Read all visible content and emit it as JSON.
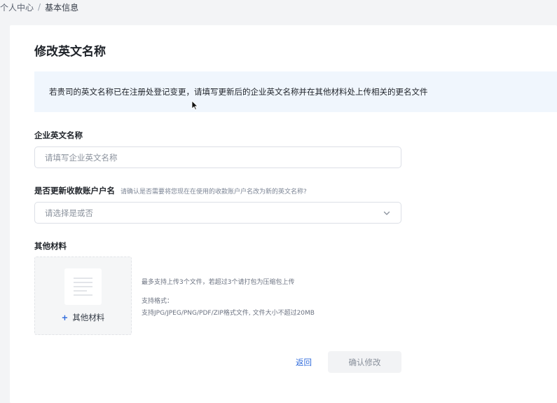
{
  "breadcrumb": {
    "parent": "个人中心",
    "separator": "/",
    "current": "基本信息"
  },
  "page": {
    "title": "修改英文名称"
  },
  "notice": {
    "text": "若贵司的英文名称已在注册处登记变更，请填写更新后的企业英文名称并在其他材料处上传相关的更名文件"
  },
  "form": {
    "english_name": {
      "label": "企业英文名称",
      "placeholder": "请填写企业英文名称",
      "value": ""
    },
    "update_account": {
      "label": "是否更新收款账户户名",
      "hint": "请确认是否需要将您现在在使用的收款账户户名改为新的英文名称?",
      "placeholder": "请选择是或否",
      "icon": "chevron-down-icon"
    },
    "other_materials": {
      "label": "其他材料",
      "upload_label": "其他材料",
      "upload_plus": "+",
      "icon": "document-icon",
      "limit_text": "最多支持上传3个文件，若超过3个请打包为压缩包上传",
      "formats_title": "支持格式：",
      "formats_text": "支持JPG/JPEG/PNG/PDF/ZIP格式文件, 文件大小不超过20MB"
    }
  },
  "actions": {
    "back_label": "返回",
    "confirm_label": "确认修改"
  },
  "colors": {
    "accent": "#2f6bdc",
    "notice_bg": "#f0f6fd",
    "page_bg": "#f3f4f6"
  }
}
